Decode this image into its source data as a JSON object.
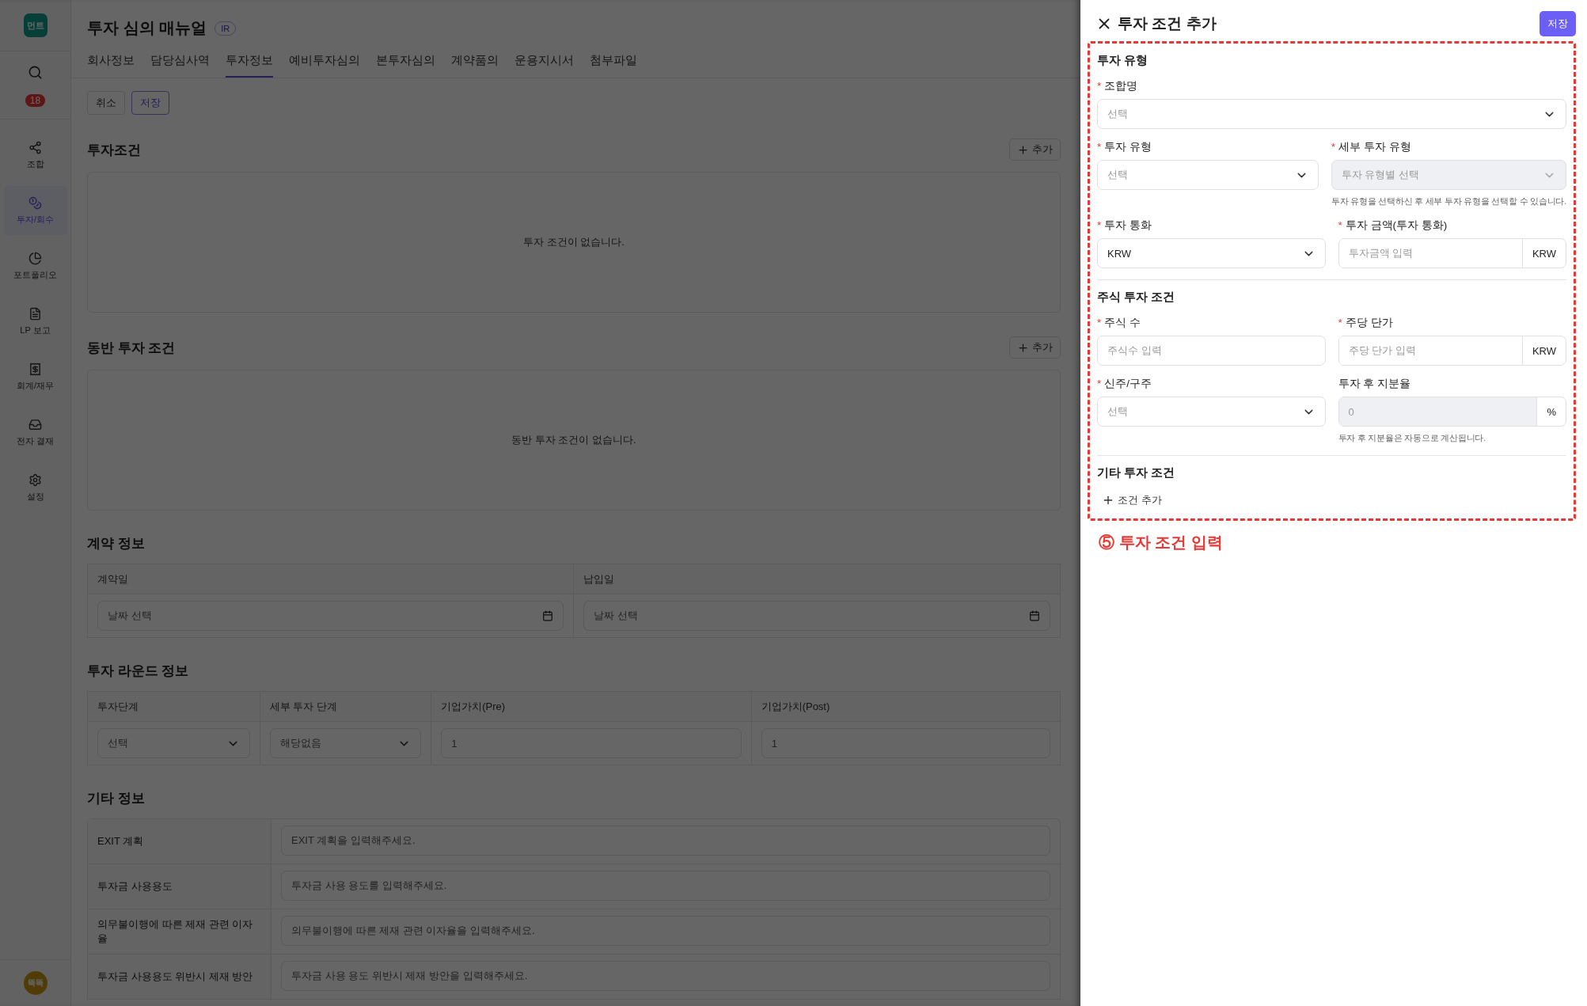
{
  "sidebar": {
    "logo": "먼트",
    "badge": "18",
    "items": [
      {
        "label": "조합",
        "selected": false
      },
      {
        "label": "투자/회수",
        "selected": true
      },
      {
        "label": "포트폴리오",
        "selected": false
      },
      {
        "label": "LP 보고",
        "selected": false
      },
      {
        "label": "회계/재무",
        "selected": false
      },
      {
        "label": "전자 결재",
        "selected": false
      },
      {
        "label": "설정",
        "selected": false
      }
    ],
    "avatar": "똑똑"
  },
  "page": {
    "title": "투자 심의 매뉴얼",
    "badge": "IR",
    "tabs": [
      {
        "label": "회사정보",
        "selected": false
      },
      {
        "label": "담당심사역",
        "selected": false
      },
      {
        "label": "투자정보",
        "selected": true
      },
      {
        "label": "예비투자심의",
        "selected": false
      },
      {
        "label": "본투자심의",
        "selected": false
      },
      {
        "label": "계약품의",
        "selected": false
      },
      {
        "label": "운용지시서",
        "selected": false
      },
      {
        "label": "첨부파일",
        "selected": false
      }
    ],
    "actions": [
      {
        "label": "취소",
        "primary": false
      },
      {
        "label": "저장",
        "primary": true
      }
    ],
    "sections": [
      {
        "kind": "empty",
        "title": "투자조건",
        "add_button": "추가",
        "message": "투자 조건이 없습니다."
      },
      {
        "kind": "empty",
        "title": "동반 투자 조건",
        "add_button": "추가",
        "message": "동반 투자 조건이 없습니다."
      },
      {
        "kind": "dates",
        "title": "계약 정보",
        "columns": [
          {
            "header": "계약일",
            "placeholder": "날짜 선택"
          },
          {
            "header": "납입일",
            "placeholder": "날짜 선택"
          }
        ]
      },
      {
        "kind": "round",
        "title": "투자 라운드 정보",
        "columns": [
          {
            "header": "투자단계",
            "kind": "select",
            "placeholder": "선택"
          },
          {
            "header": "세부 투자 단계",
            "kind": "select",
            "placeholder": "해당없음"
          },
          {
            "header": "기업가치(Pre)",
            "kind": "input",
            "placeholder": "1"
          },
          {
            "header": "기업가치(Post)",
            "kind": "input",
            "placeholder": "1"
          }
        ]
      },
      {
        "kind": "rows",
        "title": "기타 정보",
        "rows": [
          {
            "label": "EXIT 계획",
            "placeholder": "EXIT 계획을 입력해주세요."
          },
          {
            "label": "투자금 사용용도",
            "placeholder": "투자금 사용 용도를 입력해주세요."
          },
          {
            "label": "의무불이행에 따른 제재 관련 이자율",
            "placeholder": "의무불이행에 따른 제재 관련 이자율을 입력해주세요."
          },
          {
            "label": "투자금 사용용도 위반시 제재 방안",
            "placeholder": "투자금 사용 용도 위반시 제재 방안을 입력해주세요."
          }
        ]
      }
    ]
  },
  "panel": {
    "title": "투자 조건 추가",
    "save_button": "저장",
    "groups": [
      {
        "title": "투자 유형",
        "rows": [
          [
            {
              "label": "조합명",
              "required": "*",
              "kind": "select",
              "placeholder": "선택",
              "disabled": false
            }
          ],
          [
            {
              "label": "투자 유형",
              "required": "*",
              "kind": "select",
              "placeholder": "선택",
              "disabled": false
            },
            {
              "label": "세부 투자 유형",
              "required": "*",
              "kind": "select",
              "placeholder": "투자 유형별 선택",
              "disabled": true,
              "hint": "투자 유형을 선택하신 후 세부 투자 유형을 선택할 수 있습니다."
            }
          ],
          [
            {
              "label": "투자 통화",
              "required": "*",
              "kind": "select",
              "value": "KRW",
              "disabled": false
            },
            {
              "label": "투자 금액(투자 통화)",
              "required": "*",
              "kind": "input",
              "placeholder": "투자금액 입력",
              "addon": "KRW",
              "disabled": false
            }
          ]
        ]
      },
      {
        "title": "주식 투자 조건",
        "rows": [
          [
            {
              "label": "주식 수",
              "required": "*",
              "kind": "input",
              "placeholder": "주식수 입력",
              "disabled": false
            },
            {
              "label": "주당 단가",
              "required": "*",
              "kind": "input",
              "placeholder": "주당 단가 입력",
              "addon": "KRW",
              "disabled": false
            }
          ],
          [
            {
              "label": "신주/구주",
              "required": "*",
              "kind": "select",
              "placeholder": "선택",
              "disabled": false
            },
            {
              "label": "투자 후 지분율",
              "kind": "input",
              "placeholder": "0",
              "addon": "%",
              "disabled": true,
              "hint": "투자 후 지분율은 자동으로 계산됩니다."
            }
          ]
        ]
      }
    ],
    "other": {
      "title": "기타 투자 조건",
      "add_button": "조건 추가"
    },
    "annotation": {
      "number": "⑤",
      "text": "투자 조건 입력"
    }
  }
}
